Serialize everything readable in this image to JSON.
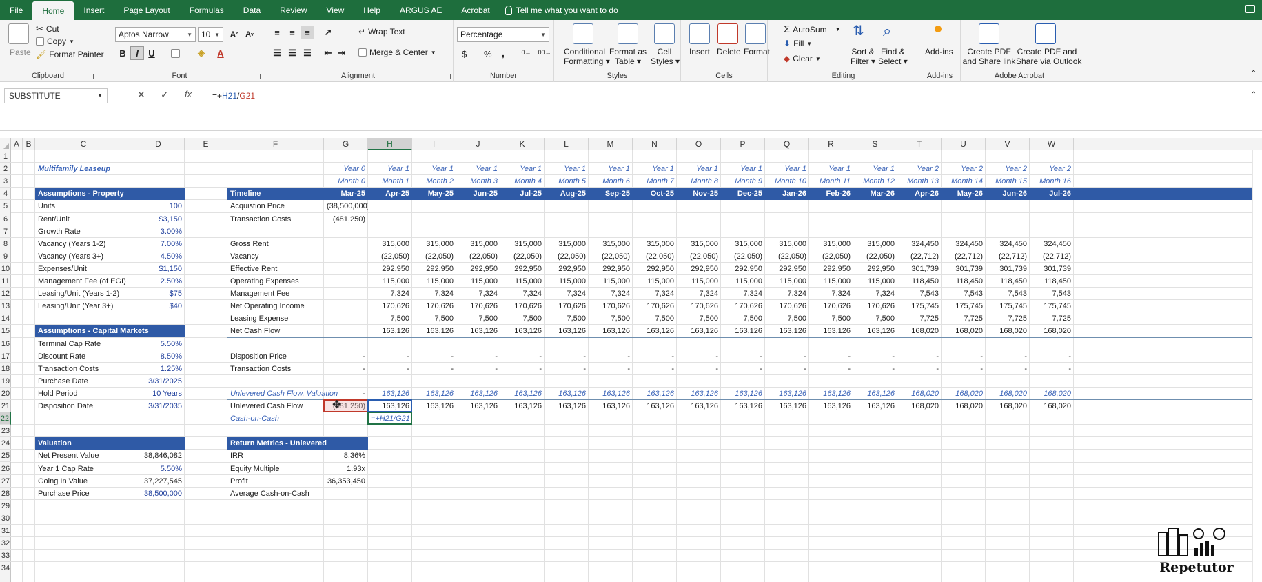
{
  "menu": [
    "File",
    "Home",
    "Insert",
    "Page Layout",
    "Formulas",
    "Data",
    "Review",
    "View",
    "Help",
    "ARGUS AE",
    "Acrobat"
  ],
  "tell_me": "Tell me what you want to do",
  "ribbon": {
    "clipboard": {
      "paste": "Paste",
      "cut": "Cut",
      "copy": "Copy",
      "format_painter": "Format Painter",
      "label": "Clipboard"
    },
    "font": {
      "family": "Aptos Narrow",
      "size": "10",
      "label": "Font"
    },
    "alignment": {
      "wrap": "Wrap Text",
      "merge": "Merge & Center",
      "label": "Alignment"
    },
    "number": {
      "format": "Percentage",
      "dollar": "$",
      "percent": "%",
      "comma": ",",
      "label": "Number"
    },
    "styles": {
      "conditional": [
        "Conditional",
        "Formatting"
      ],
      "format_table": [
        "Format as",
        "Table"
      ],
      "cell_styles": [
        "Cell",
        "Styles"
      ],
      "label": "Styles"
    },
    "cells": {
      "insert": "Insert",
      "delete": "Delete",
      "format": "Format",
      "label": "Cells"
    },
    "editing": {
      "autosum": "AutoSum",
      "fill": "Fill",
      "clear": "Clear",
      "sort": [
        "Sort &",
        "Filter"
      ],
      "find": [
        "Find &",
        "Select"
      ],
      "label": "Editing"
    },
    "addins": {
      "addins": "Add-ins",
      "label": "Add-ins"
    },
    "acrobat": {
      "create_share": [
        "Create PDF",
        "and Share link"
      ],
      "create_outlook": [
        "Create PDF and",
        "Share via Outlook"
      ],
      "label": "Adobe Acrobat"
    }
  },
  "formula_bar": {
    "name_box": "SUBSTITUTE",
    "formula_prefix": "=+",
    "ref1": "H21",
    "sep": "/",
    "ref2": "G21",
    "fx": "fx"
  },
  "columns": [
    "A",
    "B",
    "C",
    "D",
    "E",
    "F",
    "G",
    "H",
    "I",
    "J",
    "K",
    "L",
    "M",
    "N",
    "O",
    "P",
    "Q",
    "R",
    "S",
    "T",
    "U",
    "V",
    "W"
  ],
  "rows": [
    "1",
    "2",
    "3",
    "4",
    "5",
    "6",
    "7",
    "8",
    "9",
    "10",
    "11",
    "12",
    "13",
    "14",
    "15",
    "16",
    "17",
    "18",
    "19",
    "20",
    "21",
    "22",
    "23",
    "24",
    "25",
    "26",
    "27",
    "28",
    "29",
    "30",
    "31",
    "32",
    "33",
    "34"
  ],
  "sheet": {
    "title": "Multifamily Leaseup",
    "assump_prop_header": "Assumptions - Property",
    "assump_prop": [
      [
        "Units",
        "100"
      ],
      [
        "Rent/Unit",
        "$3,150"
      ],
      [
        "Growth Rate",
        "3.00%"
      ],
      [
        "Vacancy (Years 1-2)",
        "7.00%"
      ],
      [
        "Vacancy (Years 3+)",
        "4.50%"
      ],
      [
        "Expenses/Unit",
        "$1,150"
      ],
      [
        "Management Fee (of EGI)",
        "2.50%"
      ],
      [
        "Leasing/Unit (Years 1-2)",
        "$75"
      ],
      [
        "Leasing/Unit (Year 3+)",
        "$40"
      ]
    ],
    "assump_cap_header": "Assumptions - Capital Markets",
    "assump_cap": [
      [
        "Terminal Cap Rate",
        "5.50%"
      ],
      [
        "Discount Rate",
        "8.50%"
      ],
      [
        "Transaction Costs",
        "1.25%"
      ],
      [
        "Purchase Date",
        "3/31/2025"
      ],
      [
        "Hold Period",
        "10 Years"
      ],
      [
        "Disposition Date",
        "3/31/2035"
      ]
    ],
    "valuation_header": "Valuation",
    "valuation": [
      [
        "Net Present Value",
        "38,846,082"
      ],
      [
        "Year 1 Cap Rate",
        "5.50%"
      ],
      [
        "Going In Value",
        "37,227,545"
      ],
      [
        "Purchase Price",
        "38,500,000"
      ]
    ],
    "timeline_label": "Timeline",
    "years": [
      "Year 0",
      "Year 1",
      "Year 1",
      "Year 1",
      "Year 1",
      "Year 1",
      "Year 1",
      "Year 1",
      "Year 1",
      "Year 1",
      "Year 1",
      "Year 1",
      "Year 1",
      "Year 2",
      "Year 2",
      "Year 2",
      "Year 2"
    ],
    "months": [
      "Month 0",
      "Month 1",
      "Month 2",
      "Month 3",
      "Month 4",
      "Month 5",
      "Month 6",
      "Month 7",
      "Month 8",
      "Month 9",
      "Month 10",
      "Month 11",
      "Month 12",
      "Month 13",
      "Month 14",
      "Month 15",
      "Month 16"
    ],
    "dates": [
      "Mar-25",
      "Apr-25",
      "May-25",
      "Jun-25",
      "Jul-25",
      "Aug-25",
      "Sep-25",
      "Oct-25",
      "Nov-25",
      "Dec-25",
      "Jan-26",
      "Feb-26",
      "Mar-26",
      "Apr-26",
      "May-26",
      "Jun-26",
      "Jul-26"
    ],
    "acq_price": [
      "Acquistion Price",
      "(38,500,000)"
    ],
    "trans_costs": [
      "Transaction Costs",
      "(481,250)"
    ],
    "cf_rows": [
      {
        "label": "Gross Rent",
        "y1": "315,000",
        "y2": "324,450"
      },
      {
        "label": "Vacancy",
        "y1": "(22,050)",
        "y2": "(22,712)"
      },
      {
        "label": "Effective Rent",
        "y1": "292,950",
        "y2": "301,739"
      },
      {
        "label": "Operating Expenses",
        "y1": "115,000",
        "y2": "118,450"
      },
      {
        "label": "Management Fee",
        "y1": "7,324",
        "y2": "7,543"
      },
      {
        "label": "Net Operating Income",
        "y1": "170,626",
        "y2": "175,745"
      },
      {
        "label": "Leasing Expense",
        "y1": "7,500",
        "y2": "7,725"
      },
      {
        "label": "Net Cash Flow",
        "y1": "163,126",
        "y2": "168,020"
      }
    ],
    "dispo_price": "Disposition Price",
    "dispo_costs": "Transaction Costs",
    "dash": "-",
    "ucf_val_label": "Unlevered Cash Flow, Valuation",
    "ucf_label": "Unlevered Cash Flow",
    "ucf_g": "(481,250)",
    "coc_label": "Cash-on-Cash",
    "coc_editing": "=+H21/G21",
    "return_header": "Return Metrics - Unlevered",
    "returns": [
      [
        "IRR",
        "8.36%"
      ],
      [
        "Equity Multiple",
        "1.93x"
      ],
      [
        "Profit",
        "36,353,450"
      ],
      [
        "Average Cash-on-Cash",
        ""
      ]
    ]
  },
  "logo_text": "Repetutor",
  "colors": {
    "excel_green": "#1e6e3d",
    "header_blue": "#2f5aa6"
  }
}
